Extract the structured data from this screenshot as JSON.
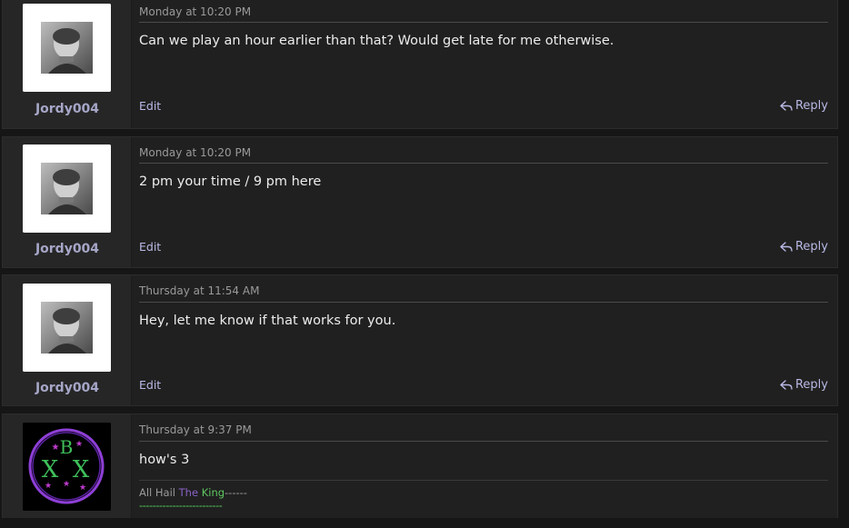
{
  "posts": [
    {
      "username": "Jordy004",
      "date": "Monday at 10:20 PM",
      "body": "Can we play an hour earlier than that? Would get late for me otherwise.",
      "edit_label": "Edit",
      "reply_label": "Reply"
    },
    {
      "username": "Jordy004",
      "date": "Monday at 10:20 PM",
      "body": "2 pm your time / 9 pm here",
      "edit_label": "Edit",
      "reply_label": "Reply"
    },
    {
      "username": "Jordy004",
      "date": "Thursday at 11:54 AM",
      "body": "Hey, let me know if that works for you.",
      "edit_label": "Edit",
      "reply_label": "Reply"
    },
    {
      "date": "Thursday at 9:37 PM",
      "body": "how's 3",
      "signature": {
        "prefix": "All Hail ",
        "the": "The",
        "king": "King",
        "suffix": "------",
        "divider": "-------------------------"
      }
    }
  ],
  "colors": {
    "username": "#a6a6c8",
    "link": "#b9b9e6",
    "background": "#202020",
    "signature_the": "#8a62c8",
    "signature_king": "#5ec861"
  },
  "icons": {
    "reply": "reply-arrow-icon",
    "avatar_photo": "grayscale-portrait-avatar",
    "avatar_logo": "purple-circle-bx-logo"
  }
}
